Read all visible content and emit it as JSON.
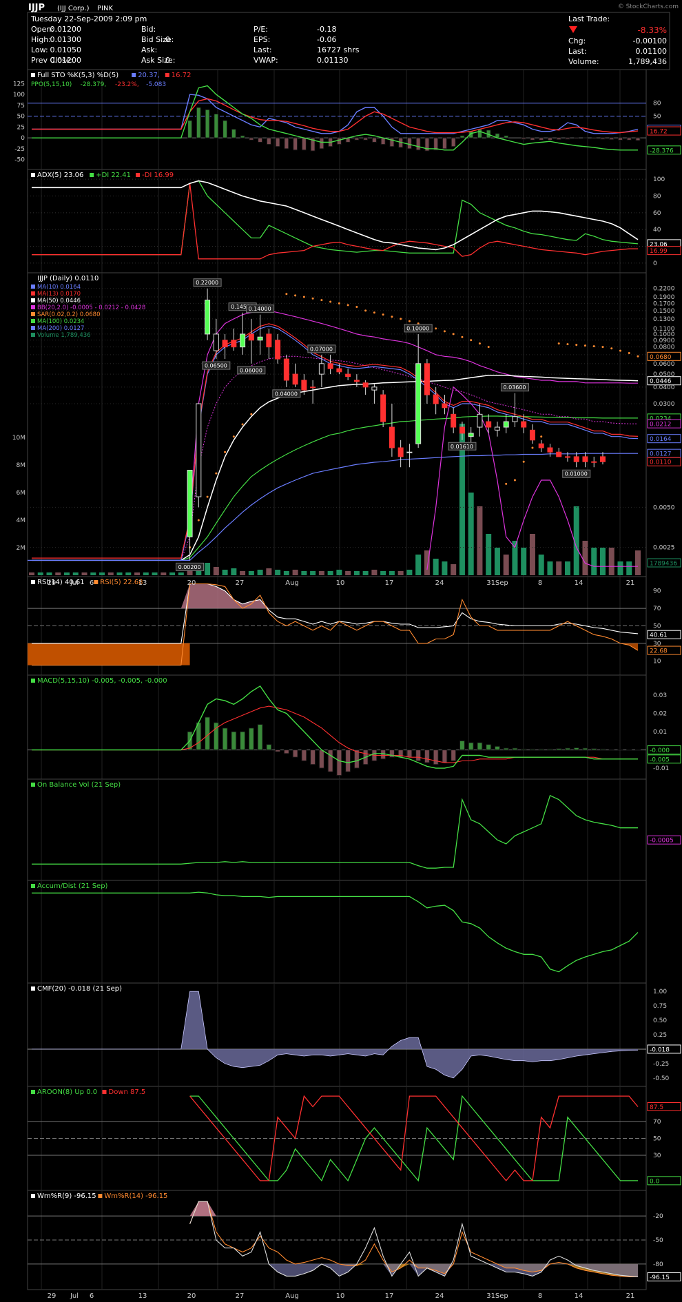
{
  "header": {
    "symbol": "IJJP",
    "company": "(IJJ Corp.)",
    "exchange": "PINK",
    "watermark": "© StockCharts.com",
    "date": "Tuesday  22-Sep-2009  2:09 pm",
    "left_rows": [
      [
        [
          "Open:",
          "0.01200"
        ],
        [
          "Bid:",
          ""
        ],
        [
          "P/E:",
          "-0.18"
        ]
      ],
      [
        [
          "High:",
          "0.01300"
        ],
        [
          "Bid Size:",
          "0"
        ],
        [
          "EPS:",
          "-0.06"
        ]
      ],
      [
        [
          "Low:",
          "0.01050"
        ],
        [
          "Ask:",
          ""
        ],
        [
          "Last:",
          "16727 shrs"
        ]
      ],
      [
        [
          "Prev Close:",
          "0.01200"
        ],
        [
          "Ask Size:",
          "0"
        ],
        [
          "VWAP:",
          "0.01130"
        ]
      ]
    ],
    "last_trade": {
      "label": "Last Trade:",
      "pct": "-8.33%",
      "chg_label": "Chg:",
      "chg": "-0.00100",
      "last_label": "Last:",
      "last": "0.01100",
      "vol_label": "Volume:",
      "volume": "1,789,436"
    }
  },
  "colors": {
    "up": "#33cc33",
    "down": "#ff2020",
    "grid": "#555555",
    "white": "#ffffff",
    "green": "#44dd44",
    "red": "#ff3030",
    "blue": "#6a7dff",
    "orange": "#ff8a30",
    "magenta": "#dd33dd",
    "volume_up": "#1e8f60",
    "volume_down": "#7a4c52"
  },
  "x_axis": {
    "ticks": [
      "29",
      "Jul",
      "6",
      "13",
      "20",
      "27",
      "Aug",
      "10",
      "17",
      "24",
      "31Sep",
      "8",
      "14",
      "21"
    ]
  },
  "chart_data": [
    {
      "type": "line",
      "id": "sto",
      "legend": [
        [
          "Full STO %K(5,3) %D(5)",
          "#ffffff"
        ],
        [
          "20.37,",
          "#6a7dff"
        ],
        [
          "16.72",
          "#ff3030"
        ]
      ],
      "legend2": [
        [
          "PPO(5,15,10)",
          "#44dd44"
        ],
        [
          "-28.379,",
          "#44dd44"
        ],
        [
          "-23.2%,",
          "#ff3030"
        ],
        [
          "-5.083",
          "#6a7dff"
        ]
      ],
      "left_ticks": [
        "125",
        "100",
        "75",
        "50",
        "25",
        "0",
        "-25",
        "-50"
      ],
      "right_ticks": [
        "80",
        "50"
      ],
      "value_labels": [
        [
          "20.37",
          "#6a7dff"
        ],
        [
          "16.72",
          "#ff3030"
        ],
        [
          "-28.376",
          "#44dd44"
        ]
      ],
      "series": [
        {
          "name": "%K",
          "color": "#6a7dff",
          "values": [
            20,
            20,
            20,
            20,
            20,
            20,
            20,
            20,
            20,
            20,
            20,
            20,
            20,
            20,
            20,
            20,
            20,
            20,
            100,
            98,
            90,
            70,
            60,
            50,
            40,
            30,
            25,
            45,
            40,
            35,
            25,
            20,
            15,
            10,
            10,
            15,
            30,
            60,
            70,
            70,
            50,
            25,
            10,
            10,
            10,
            10,
            10,
            10,
            10,
            15,
            20,
            25,
            30,
            40,
            40,
            35,
            30,
            20,
            15,
            15,
            20,
            35,
            30,
            15,
            10,
            10,
            10,
            12,
            15,
            20
          ]
        },
        {
          "name": "%D",
          "color": "#ff3030",
          "values": [
            20,
            20,
            20,
            20,
            20,
            20,
            20,
            20,
            20,
            20,
            20,
            20,
            20,
            20,
            20,
            20,
            20,
            20,
            60,
            85,
            90,
            85,
            75,
            65,
            55,
            48,
            42,
            40,
            40,
            38,
            33,
            28,
            22,
            18,
            15,
            15,
            20,
            35,
            50,
            60,
            55,
            45,
            35,
            25,
            20,
            15,
            12,
            12,
            12,
            13,
            15,
            20,
            25,
            30,
            35,
            37,
            35,
            30,
            25,
            20,
            18,
            22,
            25,
            22,
            18,
            15,
            13,
            12,
            14,
            16
          ]
        },
        {
          "name": "PPO",
          "color": "#44dd44",
          "values": [
            0,
            0,
            0,
            0,
            0,
            0,
            0,
            0,
            0,
            0,
            0,
            0,
            0,
            0,
            0,
            0,
            0,
            0,
            60,
            115,
            120,
            100,
            85,
            70,
            55,
            45,
            30,
            20,
            15,
            10,
            5,
            0,
            -5,
            -10,
            -10,
            -5,
            0,
            5,
            8,
            5,
            0,
            -5,
            -10,
            -15,
            -20,
            -25,
            -25,
            -28,
            -28,
            -10,
            10,
            15,
            8,
            0,
            -5,
            -10,
            -15,
            -12,
            -10,
            -8,
            -12,
            -15,
            -18,
            -20,
            -22,
            -25,
            -27,
            -28,
            -28,
            -28
          ]
        }
      ],
      "histogram": [
        0,
        0,
        0,
        0,
        0,
        0,
        0,
        0,
        0,
        0,
        0,
        0,
        0,
        0,
        0,
        0,
        0,
        0,
        40,
        70,
        65,
        55,
        40,
        20,
        5,
        -5,
        -10,
        -15,
        -20,
        -25,
        -28,
        -28,
        -30,
        -25,
        -20,
        -15,
        -10,
        -5,
        -5,
        -10,
        -15,
        -20,
        -22,
        -25,
        -28,
        -30,
        -28,
        -25,
        -20,
        5,
        15,
        20,
        18,
        10,
        5,
        0,
        -3,
        -5,
        -5,
        -5,
        -4,
        -3,
        -2,
        -1,
        -2,
        -3,
        -4,
        -5,
        -5,
        -6
      ],
      "ylim": [
        -60,
        135
      ]
    },
    {
      "type": "line",
      "id": "adx",
      "legend": [
        [
          "ADX(5) 23.06",
          "#ffffff"
        ],
        [
          "+DI 22.41",
          "#44dd44"
        ],
        [
          "-DI 16.99",
          "#ff3030"
        ]
      ],
      "right_ticks": [
        "100",
        "80",
        "60",
        "40",
        "20",
        "0"
      ],
      "value_labels": [
        [
          "23.06",
          "#ffffff"
        ],
        [
          "16.99",
          "#ff3030"
        ]
      ],
      "ylim": [
        -5,
        105
      ]
    },
    {
      "type": "candlestick",
      "id": "price",
      "title": "IJJP (Daily) 0.0110",
      "legend": [
        [
          "MA(10) 0.0164",
          "#6a7dff"
        ],
        [
          "MA(13) 0.0170",
          "#ff3030"
        ],
        [
          "MA(50) 0.0446",
          "#ffffff"
        ],
        [
          "BB(20,2.0) -0.0005 - 0.0212 - 0.0428",
          "#dd33dd"
        ],
        [
          "SAR(0.02,0.2) 0.0680",
          "#ff8a30"
        ],
        [
          "MA(100) 0.0234",
          "#44dd44"
        ],
        [
          "MA(200) 0.0127",
          "#6a7dff"
        ],
        [
          "Volume 1,789,436",
          "#1e8f60"
        ]
      ],
      "right_ticks": [
        "0.2200",
        "0.1900",
        "0.1700",
        "0.1500",
        "0.1300",
        "0.1100",
        "0.1000",
        "0.0900",
        "0.0800",
        "0.0700",
        "0.0600",
        "0.0500",
        "0.0400",
        "0.0300",
        "0.0050",
        "0.0025"
      ],
      "annotations": [
        "0.22000",
        "0.14500",
        "0.14000",
        "0.06500",
        "0.06000",
        "0.04000",
        "0.07000",
        "0.10000",
        "0.03600",
        "0.01610",
        "0.01000",
        "0.00200"
      ],
      "value_labels": [
        [
          "0.0680",
          "#ff8a30"
        ],
        [
          "0.0446",
          "#ffffff"
        ],
        [
          "0.0234",
          "#44dd44"
        ],
        [
          "0.0212",
          "#dd33dd"
        ],
        [
          "0.0164",
          "#6a7dff"
        ],
        [
          "0.0127",
          "#6a7dff"
        ],
        [
          "0.0110",
          "#ff3030"
        ],
        [
          "1789436",
          "#1e8f60"
        ]
      ],
      "volume_ticks": [
        "10M",
        "8M",
        "6M",
        "4M",
        "2M"
      ],
      "ylim": [
        0.0017,
        0.25
      ]
    },
    {
      "type": "line",
      "id": "rsi",
      "legend": [
        [
          "RSI(14) 40.61",
          "#ffffff"
        ],
        [
          "RSI(5) 22.68",
          "#ff8a30"
        ]
      ],
      "right_ticks": [
        "90",
        "70",
        "50",
        "30",
        "10"
      ],
      "value_labels": [
        [
          "40.61",
          "#ffffff"
        ],
        [
          "22.68",
          "#ff8a30"
        ]
      ],
      "ylim": [
        0,
        100
      ]
    },
    {
      "type": "line",
      "id": "macd",
      "legend": [
        [
          "MACD(5,15,10) -0.005, -0.005, -0.000",
          "#44dd44"
        ]
      ],
      "right_ticks": [
        "0.03",
        "0.02",
        "0.01",
        "0.000",
        "-0.01"
      ],
      "value_labels": [
        [
          "-0.000",
          "#44dd44"
        ],
        [
          "-0.005",
          "#44dd44"
        ]
      ],
      "ylim": [
        -0.013,
        0.038
      ]
    },
    {
      "type": "line",
      "id": "obv",
      "legend": [
        [
          "On Balance Vol (21 Sep)",
          "#44dd44"
        ]
      ],
      "value_labels": [
        [
          "-0.0005",
          "#dd33dd"
        ]
      ]
    },
    {
      "type": "line",
      "id": "ad",
      "legend": [
        [
          "Accum/Dist (21 Sep)",
          "#44dd44"
        ]
      ]
    },
    {
      "type": "area",
      "id": "cmf",
      "legend": [
        [
          "CMF(20) -0.018 (21 Sep)",
          "#ffffff"
        ]
      ],
      "right_ticks": [
        "1.00",
        "0.75",
        "0.50",
        "0.25",
        "-0.25",
        "-0.50"
      ],
      "value_labels": [
        [
          "-0.018",
          "#ffffff"
        ]
      ],
      "ylim": [
        -0.55,
        1.05
      ]
    },
    {
      "type": "line",
      "id": "aroon",
      "legend": [
        [
          "AROON(8) Up 0.0",
          "#44dd44"
        ],
        [
          "Down 87.5",
          "#ff3030"
        ]
      ],
      "right_ticks": [
        "70",
        "50",
        "30"
      ],
      "value_labels": [
        [
          "87.5",
          "#ff3030"
        ],
        [
          "0.0",
          "#44dd44"
        ]
      ],
      "ylim": [
        -5,
        105
      ]
    },
    {
      "type": "line",
      "id": "wr",
      "legend": [
        [
          "Wm%R(9) -96.15",
          "#ffffff"
        ],
        [
          "Wm%R(14) -96.15",
          "#ff8a30"
        ]
      ],
      "right_ticks": [
        "-20",
        "-50",
        "-80"
      ],
      "value_labels": [
        [
          "-96.15",
          "#ffffff"
        ]
      ],
      "ylim": [
        -105,
        5
      ]
    }
  ]
}
